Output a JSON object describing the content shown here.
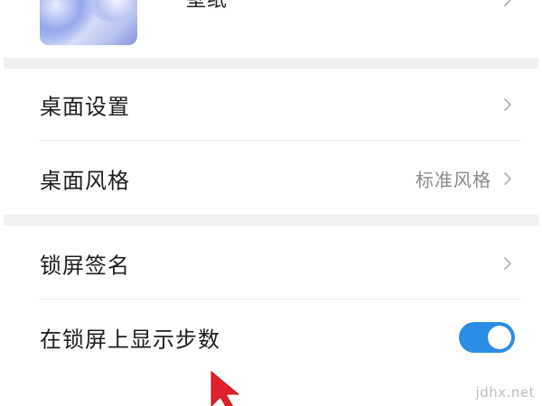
{
  "wallpaper": {
    "title": "壁纸"
  },
  "settings": {
    "desktop_settings": {
      "label": "桌面设置"
    },
    "desktop_style": {
      "label": "桌面风格",
      "value": "标准风格"
    },
    "lock_signature": {
      "label": "锁屏签名"
    },
    "show_steps": {
      "label": "在锁屏上显示步数",
      "enabled": true
    }
  },
  "colors": {
    "toggle_on": "#2a8de6",
    "pointer": "#e0202a",
    "divider_band": "#f1f1f1"
  },
  "icons": {
    "chevron": "chevron-right-icon",
    "pointer": "mouse-pointer-icon"
  },
  "watermark": "jdhx.net"
}
